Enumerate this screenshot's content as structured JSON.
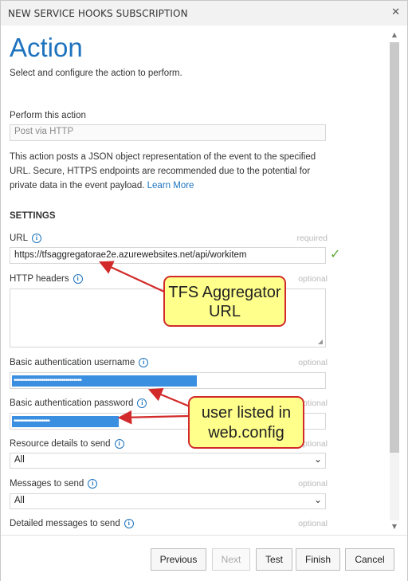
{
  "dialog": {
    "title": "NEW SERVICE HOOKS SUBSCRIPTION",
    "close_glyph": "✕"
  },
  "page": {
    "heading": "Action",
    "subtitle": "Select and configure the action to perform."
  },
  "perform_action": {
    "label": "Perform this action",
    "value": "Post via HTTP"
  },
  "description": {
    "text": "This action posts a JSON object representation of the event to the specified URL. Secure, HTTPS endpoints are recommended due to the potential for private data in the event payload.",
    "link": "Learn More"
  },
  "settings": {
    "header": "SETTINGS",
    "url": {
      "label": "URL",
      "status": "required",
      "value": "https://tfsaggregatorae2e.azurewebsites.net/api/workitem"
    },
    "http_headers": {
      "label": "HTTP headers",
      "status": "optional",
      "value": ""
    },
    "username": {
      "label": "Basic authentication username",
      "status": "optional",
      "masked": "••••••••••••••••••••••••••••••••••"
    },
    "password": {
      "label": "Basic authentication password",
      "status": "optional",
      "masked": "••••••••••••••••••"
    },
    "resource_details": {
      "label": "Resource details to send",
      "status": "optional",
      "value": "All"
    },
    "messages": {
      "label": "Messages to send",
      "status": "optional",
      "value": "All"
    },
    "detailed_messages": {
      "label": "Detailed messages to send",
      "status": "optional"
    }
  },
  "callouts": {
    "tfs": {
      "line1": "TFS Aggregator",
      "line2": "URL"
    },
    "user": {
      "line1": "user listed in",
      "line2": "web.config"
    }
  },
  "buttons": {
    "previous": "Previous",
    "next": "Next",
    "test": "Test",
    "finish": "Finish",
    "cancel": "Cancel"
  },
  "icons": {
    "info": "info-icon",
    "check": "checkmark-icon",
    "chevron": "chevron-down-icon",
    "close": "close-icon"
  },
  "colors": {
    "accent": "#1e73be",
    "callout_fill": "#ffff8c",
    "callout_border": "#d22a2a",
    "selection": "#3b8fe0",
    "valid": "#5aa832"
  }
}
